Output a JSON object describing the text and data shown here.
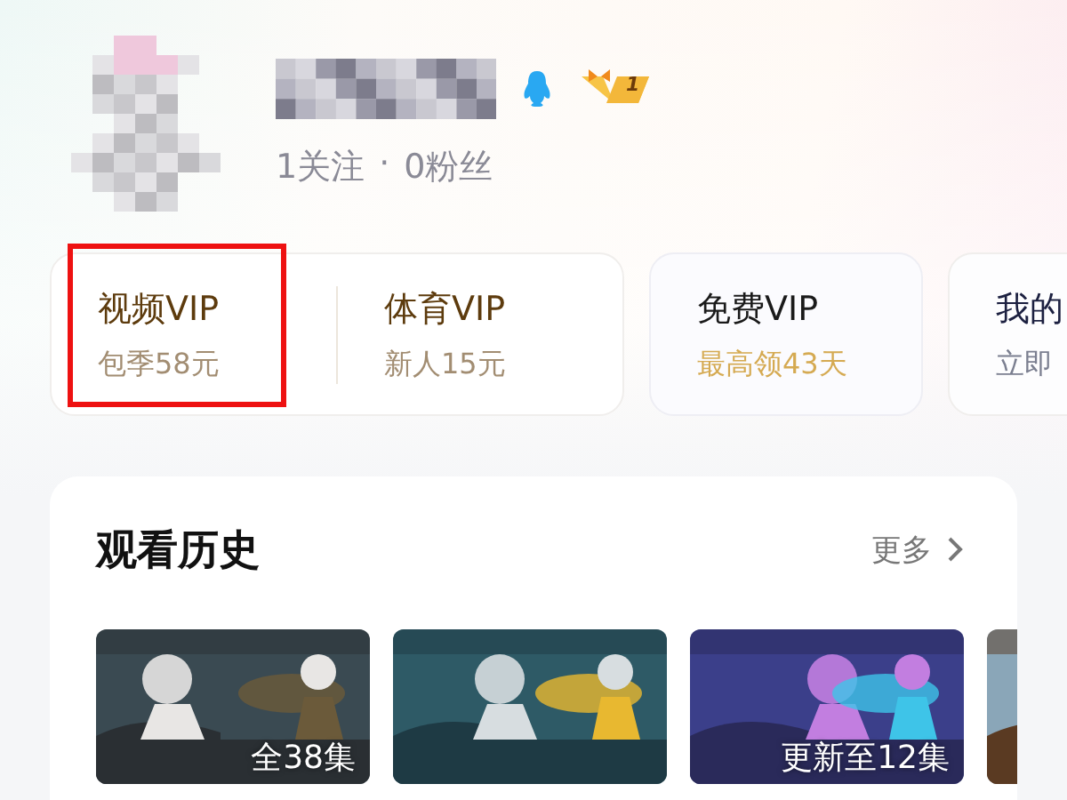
{
  "profile": {
    "stats": [
      {
        "text": "1关注"
      },
      {
        "text": "·"
      },
      {
        "text": "0粉丝"
      }
    ],
    "vip_badge": {
      "level_text": "1"
    }
  },
  "vip_cards": [
    {
      "kind": "vip",
      "items": [
        {
          "title": "视频VIP",
          "subtitle": "包季58元",
          "highlighted": true
        },
        {
          "title": "体育VIP",
          "subtitle": "新人15元",
          "highlighted": false
        }
      ]
    },
    {
      "kind": "free",
      "items": [
        {
          "title": "免费VIP",
          "subtitle": "最高领43天",
          "highlighted": false
        }
      ]
    },
    {
      "kind": "mine",
      "items": [
        {
          "title": "我的",
          "subtitle": "立即",
          "highlighted": false
        }
      ]
    }
  ],
  "history": {
    "title": "观看历史",
    "more": "更多",
    "items": [
      {
        "kind": "picture",
        "label": "全38集"
      },
      {
        "kind": "picture"
      },
      {
        "kind": "picture",
        "label": "更新至12集"
      },
      {
        "kind": "picture"
      }
    ]
  }
}
